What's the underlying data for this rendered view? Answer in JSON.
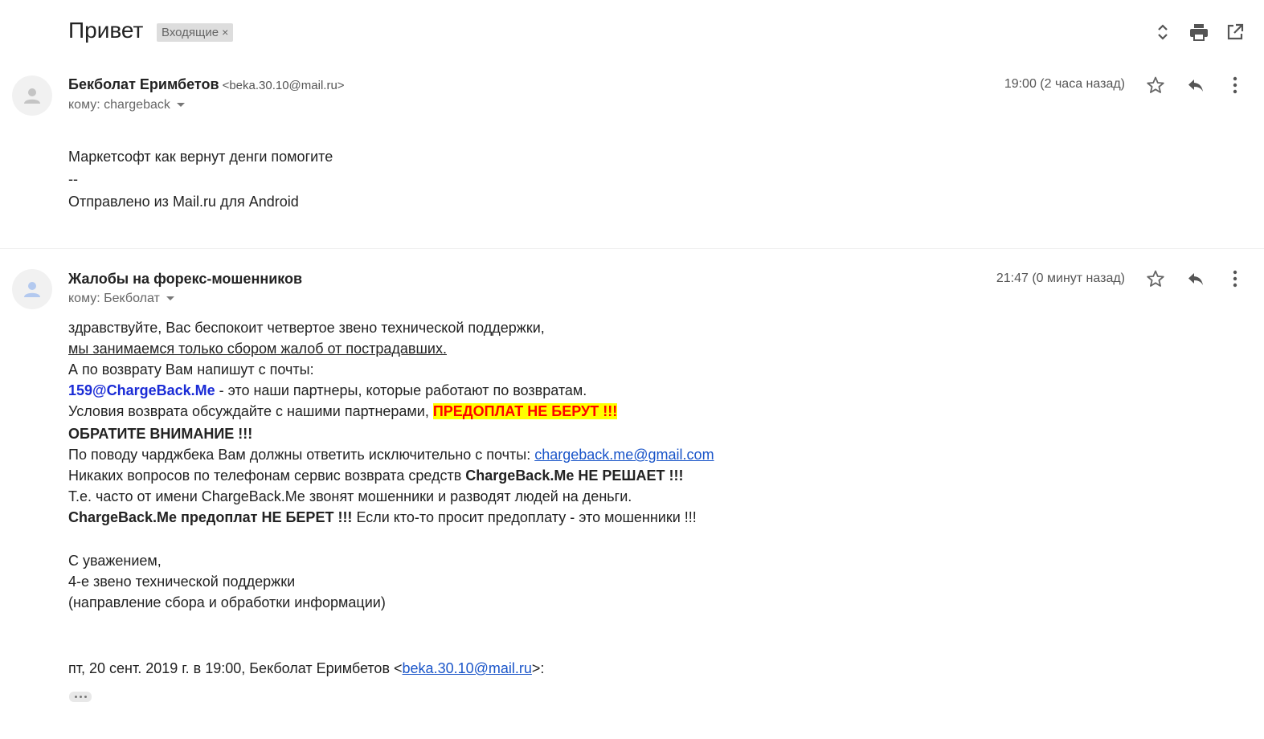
{
  "header": {
    "subject": "Привет",
    "label": "Входящие",
    "label_close": "×",
    "icons": [
      "expand-collapse-icon",
      "print-icon",
      "open-new-window-icon"
    ]
  },
  "messages": [
    {
      "sender_name": "Бекболат Еримбетов",
      "sender_email": "<beka.30.10@mail.ru>",
      "to": "кому: chargeback",
      "time": "19:00 (2 часа назад)",
      "body": [
        "Маркетсофт как вернут денги помогите",
        "--",
        "Отправлено из Mail.ru для Android"
      ]
    },
    {
      "sender_name": "Жалобы на форекс-мошенников",
      "to": "кому: Бекболат",
      "time": "21:47 (0 минут назад)",
      "body": {
        "l1": "здравствуйте, Вас беспокоит четвертое звено технической поддержки,",
        "l2": "мы занимаемся только сбором жалоб от пострадавших.",
        "l3": "А по возврату Вам напишут с почты:",
        "l4_email": "159@ChargeBack.Me",
        "l4_rest": " - это наши партнеры, которые работают по возвратам.",
        "l5_text": "Условия возврата обсуждайте с нашими партнерами, ",
        "l5_highlight": "ПРЕДОПЛАТ НЕ БЕРУТ !!!",
        "l6": "ОБРАТИТЕ ВНИМАНИЕ !!!",
        "l7_text": "По поводу чарджбека Вам должны ответить исключительно с почты: ",
        "l7_link": "chargeback.me@gmail.com",
        "l8_text": "Никаких вопросов по телефонам сервис возврата средств ",
        "l8_bold": "ChargeBack.Me НЕ РЕШАЕТ !!!",
        "l9": "Т.е. часто от имени ChargeBack.Me звонят мошенники и разводят людей на деньги.",
        "l10_bold": "ChargeBack.Me предоплат НЕ БЕРЕТ !!!",
        "l10_rest": " Если кто-то просит предоплату - это мошенники !!!",
        "sig1": "С уважением,",
        "sig2": "4-е звено технической поддержки",
        "sig3": "(направление сбора и обработки информации)",
        "quote_prefix": "пт, 20 сент. 2019 г. в 19:00, Бекболат Еримбетов <",
        "quote_link": "beka.30.10@mail.ru",
        "quote_suffix": ">:"
      }
    }
  ],
  "colors": {
    "link": "#1a55c9",
    "partner_email": "#1a2bd6",
    "warning_text": "#ff0000",
    "warning_bg": "#ffff00",
    "label_bg": "#dddddd"
  }
}
